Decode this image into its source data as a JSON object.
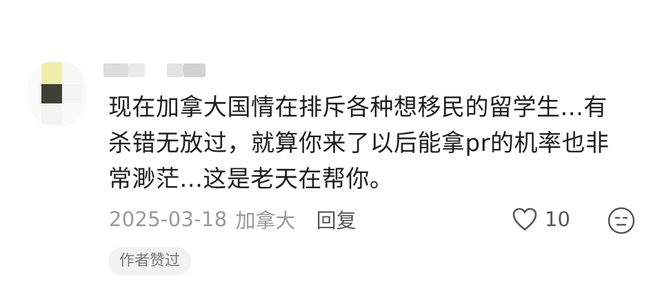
{
  "comment": {
    "lines": [
      "现在加拿大国情在排斥各种想移民的留学生...有",
      "杀错无放过，就算你来了以后能拿pr的机率也非",
      "常渺茫...这是老天在帮你。"
    ],
    "date": "2025-03-18",
    "location": "加拿大",
    "reply_label": "回复",
    "like_count": "10",
    "author_liked_badge": "作者赞过"
  },
  "icons": {
    "like": "heart-outline-icon",
    "emoji": "neutral-face-icon"
  },
  "colors": {
    "text_primary": "#1e1e1e",
    "text_secondary": "#999999",
    "text_action": "#555555",
    "badge_bg": "#f2f2f2",
    "avatar_yellow": "#efeeab",
    "avatar_dark": "#3d4033"
  }
}
